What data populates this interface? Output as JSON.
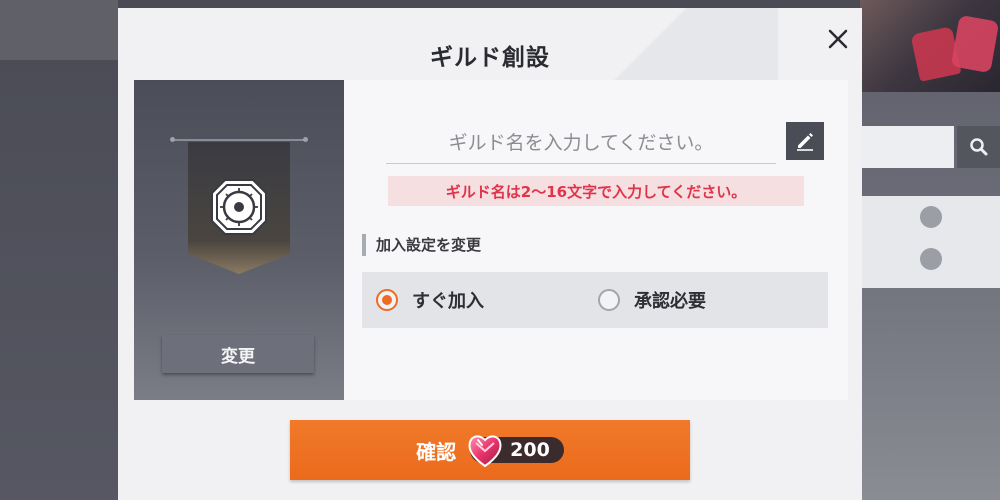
{
  "dialog": {
    "title": "ギルド創設",
    "close_icon": "close-icon"
  },
  "emblem": {
    "icon": "guild-emblem-icon",
    "change_label": "変更"
  },
  "guild_name": {
    "value": "",
    "placeholder": "ギルド名を入力してください。",
    "edit_icon": "pencil-icon",
    "error": "ギルド名は2～16文字で入力してください。"
  },
  "join_settings": {
    "label": "加入設定を変更",
    "options": [
      {
        "label": "すぐ加入",
        "selected": true
      },
      {
        "label": "承認必要",
        "selected": false
      }
    ]
  },
  "confirm": {
    "label": "確認",
    "cost": "200",
    "cost_icon": "gem-icon"
  },
  "colors": {
    "accent": "#ee6b26",
    "error_text": "#e0344b",
    "error_bg": "#f5dfe1",
    "panel_dark": "#4b4d58"
  }
}
